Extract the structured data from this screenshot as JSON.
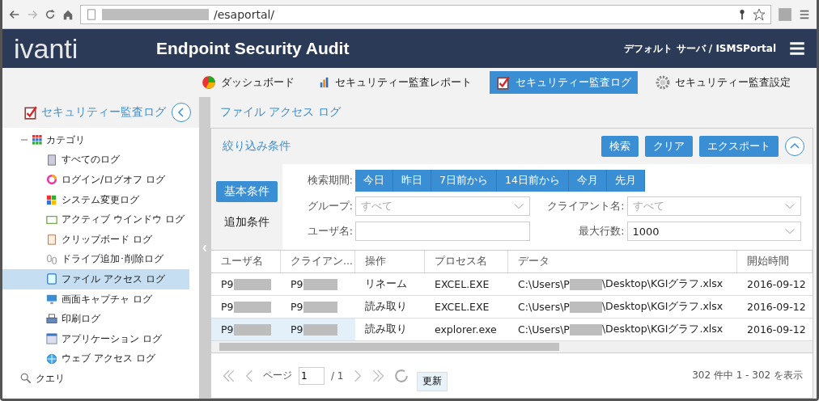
{
  "browser": {
    "url_suffix": "/esaportal/"
  },
  "header": {
    "logo": "ivanti",
    "title": "Endpoint Security Audit",
    "server": "デフォルト サーバ / ISMSPortal"
  },
  "nav": [
    {
      "label": "ダッシュボード",
      "selected": false
    },
    {
      "label": "セキュリティー監査レポート",
      "selected": false
    },
    {
      "label": "セキュリティー監査ログ",
      "selected": true
    },
    {
      "label": "セキュリティー監査設定",
      "selected": false
    }
  ],
  "sidebar": {
    "title": "セキュリティー監査ログ",
    "tree": [
      {
        "label": "カテゴリ",
        "expanded": true,
        "children": [
          {
            "label": "すべてのログ",
            "selected": false
          },
          {
            "label": "ログイン/ログオフ ログ",
            "selected": false
          },
          {
            "label": "システム変更ログ",
            "selected": false
          },
          {
            "label": "アクティブ ウインドウ ログ",
            "selected": false
          },
          {
            "label": "クリップボード ログ",
            "selected": false
          },
          {
            "label": "ドライブ追加･削除ログ",
            "selected": false
          },
          {
            "label": "ファイル アクセス ログ",
            "selected": true
          },
          {
            "label": "画面キャプチャ ログ",
            "selected": false
          },
          {
            "label": "印刷ログ",
            "selected": false
          },
          {
            "label": "アプリケーション ログ",
            "selected": false
          },
          {
            "label": "ウェブ アクセス ログ",
            "selected": false
          }
        ]
      },
      {
        "label": "クエリ"
      }
    ]
  },
  "content": {
    "title": "ファイル アクセス ログ",
    "filter": {
      "title": "絞り込み条件",
      "actions": [
        "検索",
        "クリア",
        "エクスポート"
      ],
      "tabs": [
        {
          "label": "基本条件",
          "selected": true
        },
        {
          "label": "追加条件",
          "selected": false
        }
      ],
      "period_label": "検索期間:",
      "periods": [
        "今日",
        "昨日",
        "7日前から",
        "14日前から",
        "今月",
        "先月"
      ],
      "fields": [
        {
          "label": "グループ:",
          "placeholder": "すべて",
          "kind": "select"
        },
        {
          "label": "クライアント名:",
          "placeholder": "すべて",
          "kind": "select"
        },
        {
          "label": "ユーザ名:",
          "kind": "text"
        },
        {
          "label": "最大行数:",
          "value": "1000",
          "kind": "select"
        }
      ]
    },
    "table": {
      "columns": [
        "ユーザ名",
        "クライアン...",
        "操作",
        "プロセス名",
        "データ",
        "開始時間"
      ],
      "rows": [
        {
          "user": "P9",
          "client": "P9",
          "operation": "リネーム",
          "process": "EXCEL.EXE",
          "data_start": "C:\\Users\\P",
          "data_end": "\\Desktop\\KGIグラフ.xlsx",
          "time": "2016-09-12",
          "selected": false
        },
        {
          "user": "P9",
          "client": "P9",
          "operation": "読み取り",
          "process": "EXCEL.EXE",
          "data_start": "C:\\Users\\P",
          "data_end": "\\Desktop\\KGIグラフ.xlsx",
          "time": "2016-09-12",
          "selected": false
        },
        {
          "user": "P9",
          "client": "P9",
          "operation": "読み取り",
          "process": "explorer.exe",
          "data_start": "C:\\Users\\P",
          "data_end": "\\Desktop\\KGIグラフ.xlsx",
          "time": "2016-09-12",
          "selected": true
        }
      ]
    },
    "pager": {
      "page_label": "ページ",
      "page": "1",
      "total": "/ 1",
      "refresh": "更新",
      "summary": "302 件中 1 - 302 を表示"
    }
  }
}
